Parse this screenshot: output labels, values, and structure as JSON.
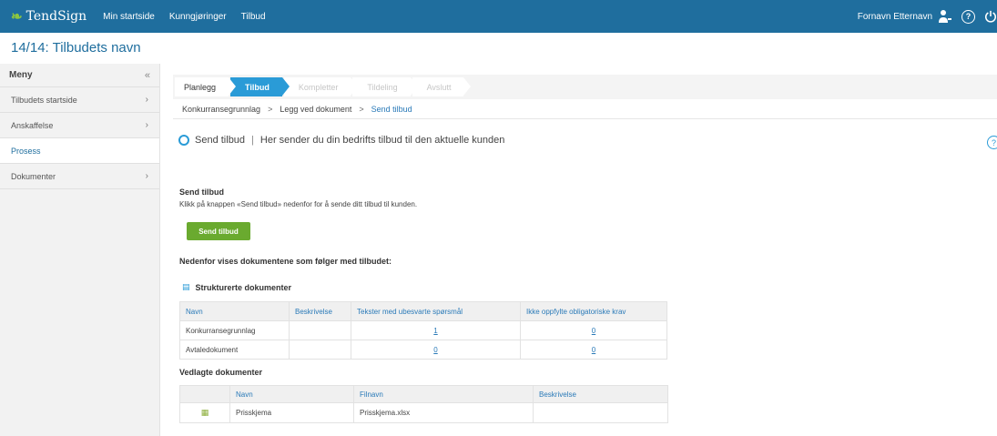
{
  "topbar": {
    "brand": "TendSign",
    "nav": [
      "Min startside",
      "Kunngjøringer",
      "Tilbud"
    ],
    "user_name": "Fornavn Etternavn",
    "help_glyph": "?"
  },
  "page_title": "14/14: Tilbudets navn",
  "sidebar": {
    "heading": "Meny",
    "collapse_glyph": "«",
    "items": [
      {
        "label": "Tilbudets startside",
        "chevron": "›"
      },
      {
        "label": "Anskaffelse",
        "chevron": "›"
      },
      {
        "label": "Prosess",
        "chevron": ""
      },
      {
        "label": "Dokumenter",
        "chevron": "›"
      }
    ]
  },
  "steps": [
    "Planlegg",
    "Tilbud",
    "Kompletter",
    "Tildeling",
    "Avslutt"
  ],
  "breadcrumbs": [
    "Konkurransegrunnlag",
    "Legg ved dokument",
    "Send tilbud"
  ],
  "breadcrumb_sep": ">",
  "heading": {
    "title": "Send tilbud",
    "separator": "|",
    "subtitle": "Her sender du din bedrifts tilbud til den aktuelle kunden"
  },
  "send_section": {
    "title": "Send tilbud",
    "description": "Klikk på knappen «Send tilbud» nedenfor for å sende ditt tilbud til kunden.",
    "button_label": "Send tilbud"
  },
  "documents_title": "Nedenfor vises dokumentene som følger med tilbudet:",
  "structured": {
    "title": "Strukturerte dokumenter",
    "icon": "structured-docs-icon",
    "columns": [
      "Navn",
      "Beskrivelse",
      "Tekster med ubesvarte spørsmål",
      "Ikke oppfylte obligatoriske krav"
    ],
    "rows": [
      {
        "name": "Konkurransegrunnlag",
        "description": "",
        "unanswered": "1",
        "unfulfilled": "0"
      },
      {
        "name": "Avtaledokument",
        "description": "",
        "unanswered": "0",
        "unfulfilled": "0"
      }
    ]
  },
  "attached": {
    "title": "Vedlagte dokumenter",
    "columns": [
      "",
      "Navn",
      "Filnavn",
      "Beskrivelse"
    ],
    "rows": [
      {
        "icon": "excel-file-icon",
        "name": "Prisskjema",
        "filename": "Prisskjema.xlsx",
        "description": ""
      }
    ]
  },
  "colors": {
    "topbar": "#1f6e9e",
    "accent": "#2a9bd7",
    "button": "#6aaa2f",
    "brand_leaf": "#8cc63f"
  }
}
